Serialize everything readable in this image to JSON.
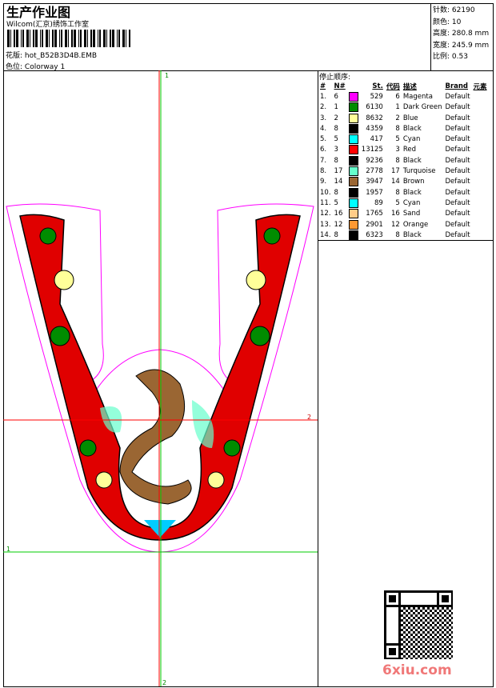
{
  "header": {
    "title": "生产作业图",
    "company": "Wilcom(汇京)绣饰工作室",
    "design_label": "花版:",
    "design_file": "hot_B52B3D4B.EMB",
    "colorway_label": "色位:",
    "colorway": "Colorway 1"
  },
  "info": [
    {
      "label": "针数:",
      "value": "62190"
    },
    {
      "label": "颜色:",
      "value": "10"
    },
    {
      "label": "高度:",
      "value": "280.8 mm"
    },
    {
      "label": "宽度:",
      "value": "245.9 mm"
    },
    {
      "label": "比例:",
      "value": "0.53"
    }
  ],
  "stop_sequence": {
    "title": "停止顺序:",
    "columns": [
      "#",
      "N#",
      "St.",
      "代码",
      "描述",
      "Brand",
      "元素"
    ],
    "rows": [
      {
        "n": "1.",
        "needle": "6",
        "color": "#ff00ff",
        "st": "529",
        "code": "6",
        "desc": "Magenta",
        "brand": "Default"
      },
      {
        "n": "2.",
        "needle": "1",
        "color": "#008c00",
        "st": "6130",
        "code": "1",
        "desc": "Dark Green",
        "brand": "Default"
      },
      {
        "n": "3.",
        "needle": "2",
        "color": "#ffff99",
        "st": "8632",
        "code": "2",
        "desc": "Blue",
        "brand": "Default"
      },
      {
        "n": "4.",
        "needle": "8",
        "color": "#000000",
        "st": "4359",
        "code": "8",
        "desc": "Black",
        "brand": "Default"
      },
      {
        "n": "5.",
        "needle": "5",
        "color": "#00ffff",
        "st": "417",
        "code": "5",
        "desc": "Cyan",
        "brand": "Default"
      },
      {
        "n": "6.",
        "needle": "3",
        "color": "#ff0000",
        "st": "13125",
        "code": "3",
        "desc": "Red",
        "brand": "Default"
      },
      {
        "n": "7.",
        "needle": "8",
        "color": "#000000",
        "st": "9236",
        "code": "8",
        "desc": "Black",
        "brand": "Default"
      },
      {
        "n": "8.",
        "needle": "17",
        "color": "#66ffcc",
        "st": "2778",
        "code": "17",
        "desc": "Turquoise",
        "brand": "Default"
      },
      {
        "n": "9.",
        "needle": "14",
        "color": "#9a6633",
        "st": "3947",
        "code": "14",
        "desc": "Brown",
        "brand": "Default"
      },
      {
        "n": "10.",
        "needle": "8",
        "color": "#000000",
        "st": "1957",
        "code": "8",
        "desc": "Black",
        "brand": "Default"
      },
      {
        "n": "11.",
        "needle": "5",
        "color": "#00ffff",
        "st": "89",
        "code": "5",
        "desc": "Cyan",
        "brand": "Default"
      },
      {
        "n": "12.",
        "needle": "16",
        "color": "#ffcc88",
        "st": "1765",
        "code": "16",
        "desc": "Sand",
        "brand": "Default"
      },
      {
        "n": "13.",
        "needle": "12",
        "color": "#ff9933",
        "st": "2901",
        "code": "12",
        "desc": "Orange",
        "brand": "Default"
      },
      {
        "n": "14.",
        "needle": "8",
        "color": "#000000",
        "st": "6323",
        "code": "8",
        "desc": "Black",
        "brand": "Default"
      }
    ]
  },
  "guides": {
    "v_top": "1",
    "v_bottom": "2",
    "h_left": "1",
    "h_right": "2"
  },
  "watermark": "6xiu.com"
}
